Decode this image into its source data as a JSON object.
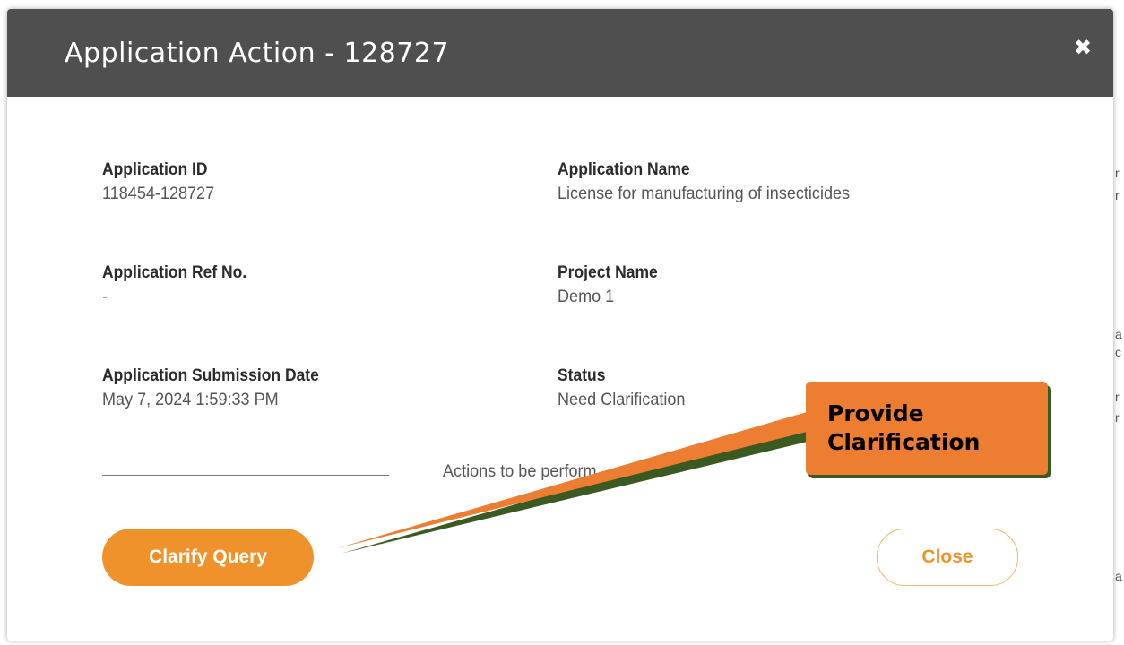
{
  "modal": {
    "title": "Application Action - 128727",
    "close_icon": "close-icon"
  },
  "fields": {
    "application_id": {
      "label": "Application ID",
      "value": "118454-128727"
    },
    "application_name": {
      "label": "Application Name",
      "value": "License for manufacturing of insecticides"
    },
    "application_ref_no": {
      "label": "Application Ref No.",
      "value": "-"
    },
    "project_name": {
      "label": "Project Name",
      "value": "Demo 1"
    },
    "submission_date": {
      "label": "Application Submission Date",
      "value": "May 7, 2024 1:59:33 PM"
    },
    "status": {
      "label": "Status",
      "value": "Need Clarification"
    }
  },
  "actions": {
    "label": "Actions to be perform",
    "clarify_button": "Clarify Query",
    "close_button": "Close"
  },
  "annotation": {
    "text": "Provide Clarification"
  },
  "colors": {
    "header": "#4f4f4f",
    "accent": "#f0922b",
    "callout": "#ed7d31",
    "callout_shadow": "#3b5a22"
  }
}
